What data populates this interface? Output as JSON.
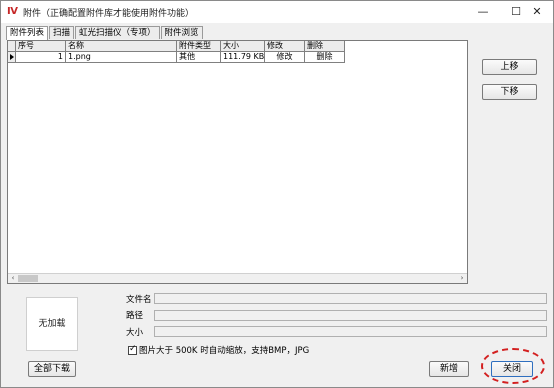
{
  "window": {
    "logo_text": "Ⅳ",
    "title": "附件（正确配置附件库才能使用附件功能）",
    "minimize": "—",
    "maximize": "☐",
    "close": "✕"
  },
  "tabs": [
    {
      "label": "附件列表",
      "active": true
    },
    {
      "label": "扫描",
      "active": false
    },
    {
      "label": "虹光扫描仪（专项）",
      "active": false
    },
    {
      "label": "附件浏览",
      "active": false
    }
  ],
  "grid": {
    "columns": [
      "序号",
      "名称",
      "附件类型",
      "大小",
      "修改",
      "删除"
    ],
    "rows": [
      {
        "index": "1",
        "name": "1.png",
        "type": "其他",
        "size": "111.79 KB",
        "edit": "修改",
        "delete": "删除"
      }
    ],
    "scroll_left": "‹",
    "scroll_right": "›"
  },
  "side_buttons": {
    "move_up": "上移",
    "move_down": "下移"
  },
  "preview": {
    "text": "无加载"
  },
  "fields": {
    "filename_label": "文件名",
    "filename_value": "",
    "path_label": "路径",
    "path_value": "",
    "size_label": "大小",
    "size_value": ""
  },
  "option": {
    "checked": true,
    "label": "图片大于 500K 时自动缩放，支持BMP，JPG"
  },
  "buttons": {
    "download_all": "全部下载",
    "new": "新增",
    "close": "关闭"
  },
  "colors": {
    "highlight": "#d32020",
    "logo": "#c62828"
  }
}
